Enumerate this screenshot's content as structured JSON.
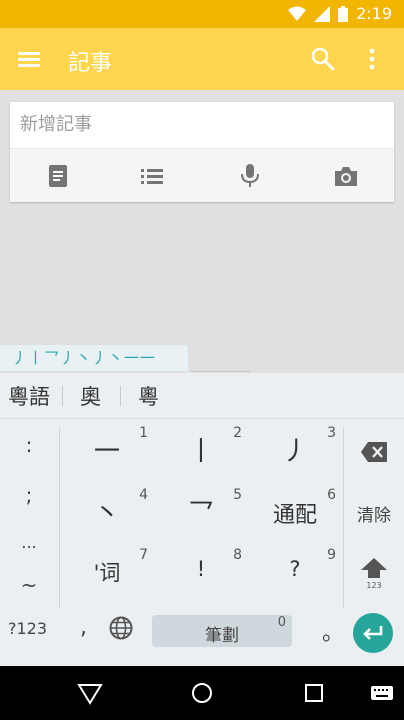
{
  "status": {
    "time": "2:19"
  },
  "toolbar": {
    "title": "記事"
  },
  "note": {
    "placeholder": "新增記事"
  },
  "ime": {
    "stroke_input": "丿丨乛丿丶丿丶一一",
    "suggestions": [
      "粵語",
      "奧",
      "粵"
    ]
  },
  "keyboard": {
    "left": [
      ":",
      ";",
      "...",
      "~"
    ],
    "keys": [
      {
        "label": "一",
        "num": "1"
      },
      {
        "label": "丨",
        "num": "2"
      },
      {
        "label": "丿",
        "num": "3"
      },
      {
        "label": "丶",
        "num": "4"
      },
      {
        "label": "乛",
        "num": "5"
      },
      {
        "label": "通配",
        "num": "6"
      },
      {
        "label": "'词",
        "num": "7"
      },
      {
        "label": "!",
        "num": "8"
      },
      {
        "label": "?",
        "num": "9"
      }
    ],
    "clear_label": "清除",
    "shift_label": "123",
    "symbols_label": "?123",
    "comma_label": ",",
    "space_label": "筆劃",
    "space_num": "0",
    "period_label": "。"
  },
  "colors": {
    "accent": "#ffd54f",
    "status": "#f2b600",
    "enter": "#26a69a"
  }
}
